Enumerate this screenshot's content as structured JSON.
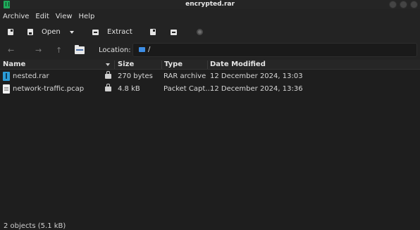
{
  "window": {
    "title": "encrypted.rar"
  },
  "menu": {
    "items": [
      "Archive",
      "Edit",
      "View",
      "Help"
    ]
  },
  "toolbar": {
    "open_label": "Open",
    "extract_label": "Extract"
  },
  "location": {
    "label": "Location:",
    "path": "/"
  },
  "columns": {
    "name": "Name",
    "size": "Size",
    "type": "Type",
    "modified": "Date Modified"
  },
  "files": [
    {
      "name": "nested.rar",
      "icon": "rar-archive-icon",
      "encrypted": true,
      "size": "270 bytes",
      "type": "RAR archive",
      "modified": "12 December 2024, 13:03"
    },
    {
      "name": "network-traffic.pcap",
      "icon": "pcap-file-icon",
      "encrypted": true,
      "size": "4.8 kB",
      "type": "Packet Capt…",
      "modified": "12 December 2024, 13:36"
    }
  ],
  "status": {
    "text": "2 objects (5.1 kB)"
  },
  "colors": {
    "background": "#1e1e1e",
    "chrome": "#232323",
    "accent_folder": "#3d8ee6",
    "rar_icon": "#2b9bd6",
    "app_icon": "#1fa85a"
  }
}
